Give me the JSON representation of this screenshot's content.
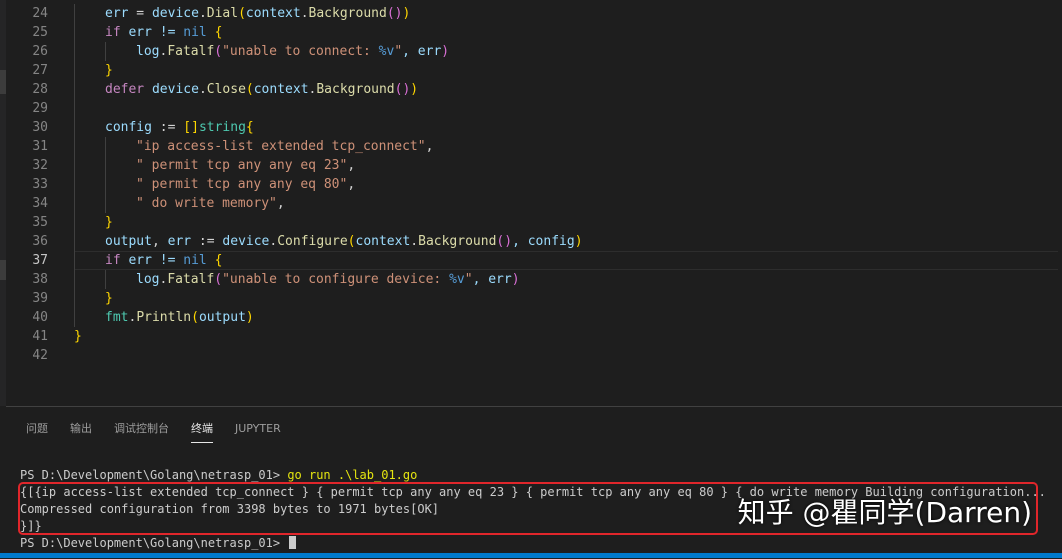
{
  "editor": {
    "lines": [
      {
        "n": "24",
        "tokens": [
          [
            "err",
            "t-var"
          ],
          [
            " = ",
            "t-id"
          ],
          [
            "device",
            "t-var"
          ],
          [
            ".",
            "t-id"
          ],
          [
            "Dial",
            "t-fn"
          ],
          [
            "(",
            "t-b1"
          ],
          [
            "context",
            "t-var"
          ],
          [
            ".",
            "t-id"
          ],
          [
            "Background",
            "t-fn"
          ],
          [
            "()",
            "t-b2"
          ],
          [
            ")",
            "t-b1"
          ]
        ],
        "indent": 1
      },
      {
        "n": "25",
        "tokens": [
          [
            "if",
            "t-ctl"
          ],
          [
            " err != ",
            "t-var"
          ],
          [
            "nil",
            "t-kw"
          ],
          [
            " {",
            "t-b1"
          ]
        ],
        "indent": 1
      },
      {
        "n": "26",
        "tokens": [
          [
            "log",
            "t-var"
          ],
          [
            ".",
            "t-id"
          ],
          [
            "Fatalf",
            "t-fn"
          ],
          [
            "(",
            "t-b2"
          ],
          [
            "\"unable to connect: ",
            "t-str"
          ],
          [
            "%v",
            "t-kw"
          ],
          [
            "\"",
            "t-str"
          ],
          [
            ", err",
            "t-var"
          ],
          [
            ")",
            "t-b2"
          ]
        ],
        "indent": 2
      },
      {
        "n": "27",
        "tokens": [
          [
            "}",
            "t-b1"
          ]
        ],
        "indent": 1
      },
      {
        "n": "28",
        "tokens": [
          [
            "defer",
            "t-ctl"
          ],
          [
            " device",
            "t-var"
          ],
          [
            ".",
            "t-id"
          ],
          [
            "Close",
            "t-fn"
          ],
          [
            "(",
            "t-b1"
          ],
          [
            "context",
            "t-var"
          ],
          [
            ".",
            "t-id"
          ],
          [
            "Background",
            "t-fn"
          ],
          [
            "()",
            "t-b2"
          ],
          [
            ")",
            "t-b1"
          ]
        ],
        "indent": 1
      },
      {
        "n": "29",
        "tokens": [],
        "indent": 1
      },
      {
        "n": "30",
        "tokens": [
          [
            "config",
            "t-var"
          ],
          [
            " := ",
            "t-id"
          ],
          [
            "[]",
            "t-b1"
          ],
          [
            "string",
            "t-type"
          ],
          [
            "{",
            "t-b1"
          ]
        ],
        "indent": 1
      },
      {
        "n": "31",
        "tokens": [
          [
            "\"ip access-list extended tcp_connect\"",
            "t-str"
          ],
          [
            ",",
            "t-id"
          ]
        ],
        "indent": 2
      },
      {
        "n": "32",
        "tokens": [
          [
            "\" permit tcp any any eq 23\"",
            "t-str"
          ],
          [
            ",",
            "t-id"
          ]
        ],
        "indent": 2
      },
      {
        "n": "33",
        "tokens": [
          [
            "\" permit tcp any any eq 80\"",
            "t-str"
          ],
          [
            ",",
            "t-id"
          ]
        ],
        "indent": 2
      },
      {
        "n": "34",
        "tokens": [
          [
            "\" do write memory\"",
            "t-str"
          ],
          [
            ",",
            "t-id"
          ]
        ],
        "indent": 2
      },
      {
        "n": "35",
        "tokens": [
          [
            "}",
            "t-b1"
          ]
        ],
        "indent": 1
      },
      {
        "n": "36",
        "tokens": [
          [
            "output",
            "t-var"
          ],
          [
            ", ",
            "t-id"
          ],
          [
            "err",
            "t-var"
          ],
          [
            " := ",
            "t-id"
          ],
          [
            "device",
            "t-var"
          ],
          [
            ".",
            "t-id"
          ],
          [
            "Configure",
            "t-fn"
          ],
          [
            "(",
            "t-b1"
          ],
          [
            "context",
            "t-var"
          ],
          [
            ".",
            "t-id"
          ],
          [
            "Background",
            "t-fn"
          ],
          [
            "()",
            "t-b2"
          ],
          [
            ", config",
            "t-var"
          ],
          [
            ")",
            "t-b1"
          ]
        ],
        "indent": 1
      },
      {
        "n": "37",
        "tokens": [
          [
            "if",
            "t-ctl"
          ],
          [
            " err != ",
            "t-var"
          ],
          [
            "nil",
            "t-kw"
          ],
          [
            " {",
            "t-b1"
          ]
        ],
        "indent": 1,
        "active": true
      },
      {
        "n": "38",
        "tokens": [
          [
            "log",
            "t-var"
          ],
          [
            ".",
            "t-id"
          ],
          [
            "Fatalf",
            "t-fn"
          ],
          [
            "(",
            "t-b2"
          ],
          [
            "\"unable to configure device: ",
            "t-str"
          ],
          [
            "%v",
            "t-kw"
          ],
          [
            "\"",
            "t-str"
          ],
          [
            ", err",
            "t-var"
          ],
          [
            ")",
            "t-b2"
          ]
        ],
        "indent": 2
      },
      {
        "n": "39",
        "tokens": [
          [
            "}",
            "t-b1"
          ]
        ],
        "indent": 1
      },
      {
        "n": "40",
        "tokens": [
          [
            "fmt",
            "t-type"
          ],
          [
            ".",
            "t-id"
          ],
          [
            "Println",
            "t-fn"
          ],
          [
            "(",
            "t-b1"
          ],
          [
            "output",
            "t-var"
          ],
          [
            ")",
            "t-b1"
          ]
        ],
        "indent": 1
      },
      {
        "n": "41",
        "tokens": [
          [
            "}",
            "t-b1"
          ]
        ],
        "indent": 0
      },
      {
        "n": "42",
        "tokens": [],
        "indent": 0
      }
    ]
  },
  "panel": {
    "tabs": [
      {
        "label": "问题",
        "active": false
      },
      {
        "label": "输出",
        "active": false
      },
      {
        "label": "调试控制台",
        "active": false
      },
      {
        "label": "终端",
        "active": true
      },
      {
        "label": "JUPYTER",
        "active": false
      }
    ]
  },
  "terminal": {
    "prompt1": "PS D:\\Development\\Golang\\netrasp_01> ",
    "command1": "go run .\\lab_01.go",
    "out1": "{[{ip access-list extended tcp_connect } { permit tcp any any eq 23 } { permit tcp any any eq 80 } { do write memory Building configuration...",
    "out2": "Compressed configuration from 3398 bytes to 1971 bytes[OK]",
    "out3": "}]}",
    "prompt2": "PS D:\\Development\\Golang\\netrasp_01> "
  },
  "watermark": "知乎 @瞿同学(Darren)",
  "colors": {
    "accent": "#007acc",
    "highlight_box": "#e0262b"
  }
}
